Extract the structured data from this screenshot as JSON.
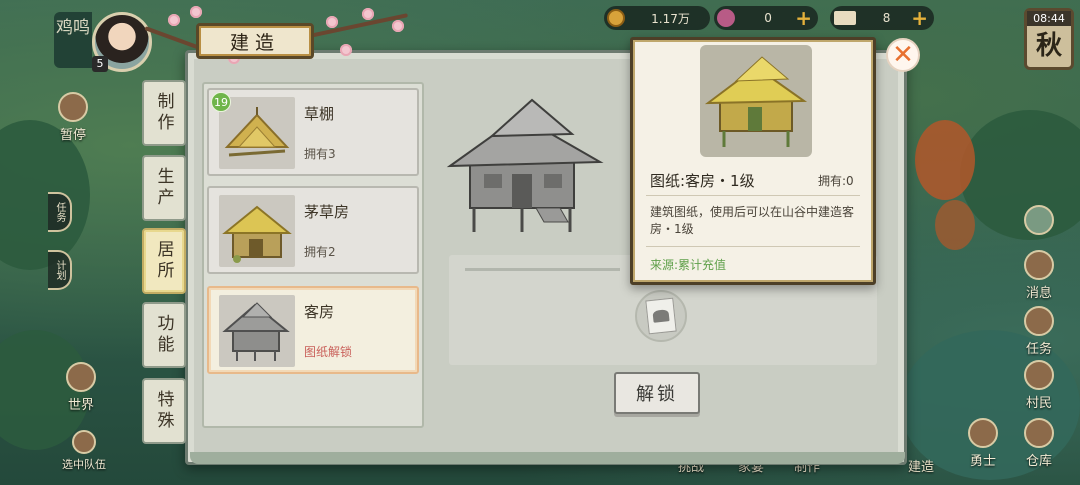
{
  "hud": {
    "player_name": "鸡鸣",
    "player_level": "5",
    "coins": "1.17万",
    "gems": "0",
    "tickets": "8",
    "time": "08:44",
    "season": "秋",
    "left_menu": [
      "暂停",
      "任务",
      "计划",
      "世界",
      "选中队伍"
    ],
    "right_menu": [
      "消息",
      "任务",
      "村民",
      "仓库",
      "勇士",
      "建造"
    ],
    "bottom_menu": [
      "挑战",
      "家宴",
      "制作"
    ]
  },
  "panel": {
    "title": "建造",
    "close_icon": "close-icon",
    "categories": [
      {
        "label": "制作",
        "active": false
      },
      {
        "label": "生产",
        "active": false
      },
      {
        "label": "居所",
        "active": true
      },
      {
        "label": "功能",
        "active": false
      },
      {
        "label": "特殊",
        "active": false
      }
    ],
    "items": [
      {
        "name": "草棚",
        "status": "拥有3",
        "badge": "19"
      },
      {
        "name": "茅草房",
        "status": "拥有2"
      },
      {
        "name": "客房",
        "status": "图纸解锁",
        "selected": true
      }
    ],
    "unlock_label": "解锁"
  },
  "tooltip": {
    "title": "图纸:客房・1级",
    "owned": "拥有:0",
    "description": "建筑图纸，使用后可以在山谷中建造客房・1级",
    "source": "来源:累计充值"
  },
  "colors": {
    "accent_orange": "#e8702f",
    "unlock_red": "#c9605a",
    "source_green": "#5fa04a",
    "badge_green": "#6fb54a"
  }
}
